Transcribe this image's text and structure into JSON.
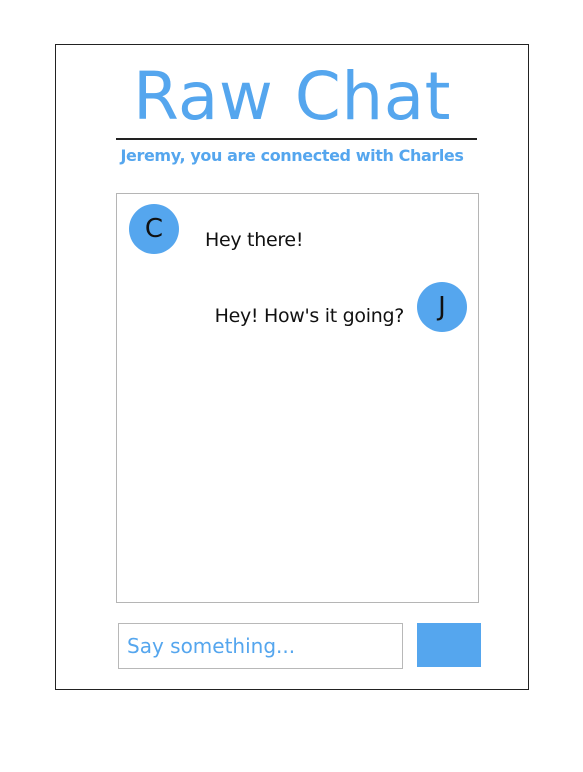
{
  "app": {
    "title": "Raw Chat",
    "connection_status": "Jeremy, you are connected with Charles"
  },
  "messages": [
    {
      "avatar_initial": "C",
      "text": "Hey there!",
      "side": "left"
    },
    {
      "avatar_initial": "J",
      "text": "Hey! How's it going?",
      "side": "right"
    }
  ],
  "composer": {
    "placeholder": "Say something...",
    "value": "",
    "send_label": ""
  },
  "colors": {
    "accent": "#55a6ee",
    "text": "#111111",
    "border": "#b5b5b5"
  }
}
